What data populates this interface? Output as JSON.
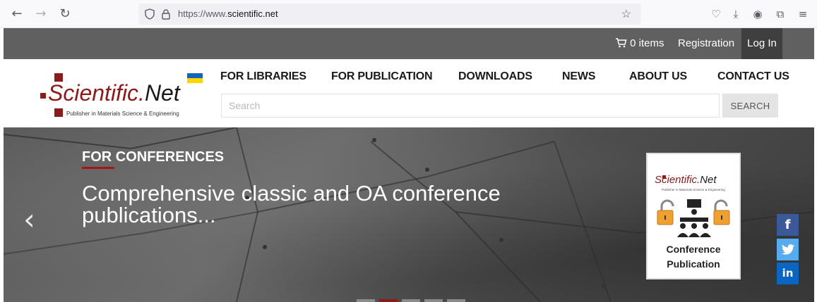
{
  "browser": {
    "url_prefix": "https://www.",
    "url_domain": "scientific.net"
  },
  "topbar": {
    "cart_label": "0 items",
    "registration_label": "Registration",
    "login_label": "Log In"
  },
  "logo": {
    "name_main": "Scientific.",
    "name_tail": "Net",
    "subtitle": "Publisher in Materials Science & Engineering",
    "flag_colors": [
      "#1565c0",
      "#ffd500"
    ]
  },
  "menu": [
    {
      "label": "FOR LIBRARIES"
    },
    {
      "label": "FOR PUBLICATION"
    },
    {
      "label": "DOWNLOADS"
    },
    {
      "label": "NEWS"
    },
    {
      "label": "ABOUT US"
    },
    {
      "label": "CONTACT US"
    }
  ],
  "search": {
    "placeholder": "Search",
    "button_label": "SEARCH"
  },
  "hero": {
    "kicker": "FOR CONFERENCES",
    "title": "Comprehensive classic and OA conference publications...",
    "accent_color": "#a01818",
    "card": {
      "logo_main": "Scientific.",
      "logo_tail": "Net",
      "logo_sub": "Publisher in Materials Science & Engineering",
      "caption_line1": "Conference",
      "caption_line2": "Publication"
    },
    "slide_count": 5,
    "active_slide": 2
  },
  "social": [
    {
      "name": "facebook",
      "glyph": "f",
      "color": "#3b5998"
    },
    {
      "name": "twitter",
      "glyph": "t",
      "color": "#55acee"
    },
    {
      "name": "linkedin",
      "glyph": "in",
      "color": "#0a66c2"
    }
  ]
}
